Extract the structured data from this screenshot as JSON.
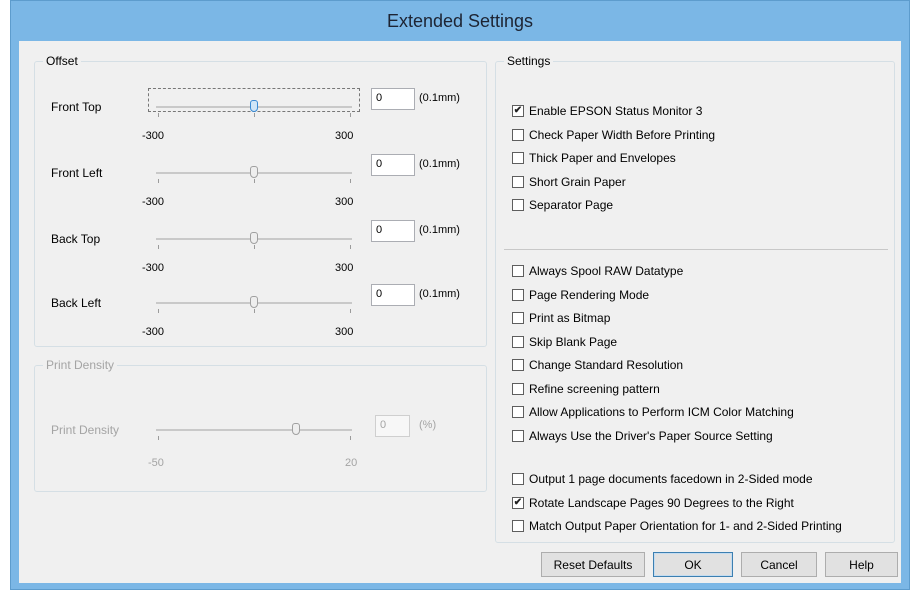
{
  "window": {
    "title": "Extended Settings"
  },
  "offset": {
    "title": "Offset",
    "rows": [
      {
        "label": "Front Top",
        "value": "0",
        "unit": "(0.1mm)",
        "min_label": "-300",
        "max_label": "300",
        "level": 0.0
      },
      {
        "label": "Front Left",
        "value": "0",
        "unit": "(0.1mm)",
        "min_label": "-300",
        "max_label": "300",
        "level": 0.0
      },
      {
        "label": "Back Top",
        "value": "0",
        "unit": "(0.1mm)",
        "min_label": "-300",
        "max_label": "300",
        "level": 0.0
      },
      {
        "label": "Back Left",
        "value": "0",
        "unit": "(0.1mm)",
        "min_label": "-300",
        "max_label": "300",
        "level": 0.0
      }
    ]
  },
  "print_density": {
    "title": "Print Density",
    "label": "Print Density",
    "value": "0",
    "unit": "(%)",
    "min_label": "-50",
    "max_label": "20",
    "level": 0.0
  },
  "settings": {
    "title": "Settings",
    "group1": [
      {
        "label": "Enable EPSON Status Monitor 3",
        "checked": true
      },
      {
        "label": "Check Paper Width Before Printing",
        "checked": false
      },
      {
        "label": "Thick Paper and Envelopes",
        "checked": false
      },
      {
        "label": "Short Grain Paper",
        "checked": false
      },
      {
        "label": "Separator Page",
        "checked": false
      }
    ],
    "group2": [
      {
        "label": "Always Spool RAW Datatype",
        "checked": false
      },
      {
        "label": "Page Rendering Mode",
        "checked": false
      },
      {
        "label": "Print as Bitmap",
        "checked": false
      },
      {
        "label": "Skip Blank Page",
        "checked": false
      },
      {
        "label": "Change Standard Resolution",
        "checked": false
      },
      {
        "label": "Refine screening pattern",
        "checked": false
      },
      {
        "label": "Allow Applications to Perform ICM Color Matching",
        "checked": false
      },
      {
        "label": "Always Use the Driver's Paper Source Setting",
        "checked": false
      }
    ],
    "group3": [
      {
        "label": "Output 1 page documents facedown in 2-Sided mode",
        "checked": false
      },
      {
        "label": "Rotate Landscape Pages 90 Degrees to the Right",
        "checked": true
      },
      {
        "label": "Match Output Paper Orientation for 1- and 2-Sided Printing",
        "checked": false
      }
    ]
  },
  "buttons": {
    "reset": "Reset Defaults",
    "ok": "OK",
    "cancel": "Cancel",
    "help": "Help"
  }
}
